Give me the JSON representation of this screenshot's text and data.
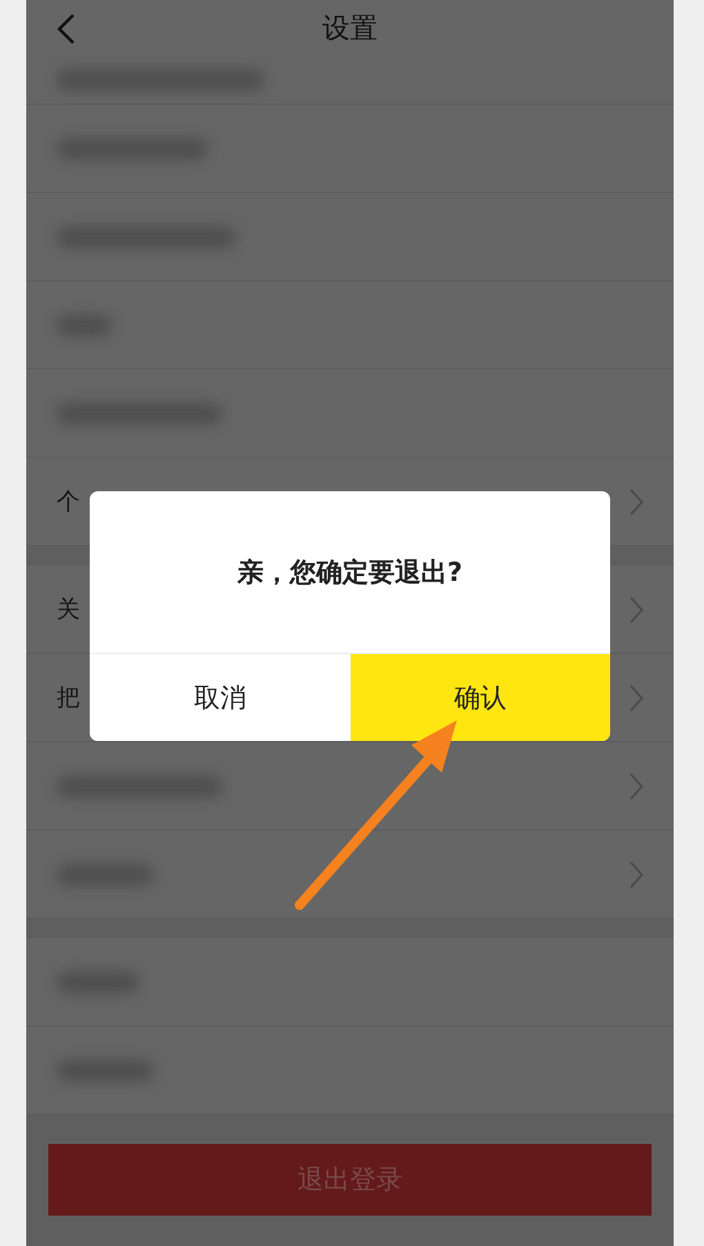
{
  "header": {
    "title": "设置"
  },
  "sections": [
    {
      "rows": [
        {
          "kind": "blurred",
          "chevron": false
        },
        {
          "kind": "blurred",
          "chevron": false
        },
        {
          "kind": "blurred",
          "chevron": false
        },
        {
          "kind": "blurred",
          "chevron": false
        },
        {
          "kind": "blurred",
          "chevron": false
        },
        {
          "kind": "text",
          "label": "个",
          "chevron": true
        }
      ]
    },
    {
      "rows": [
        {
          "kind": "text",
          "label": "关",
          "chevron": true
        },
        {
          "kind": "text",
          "label": "把",
          "chevron": true
        },
        {
          "kind": "blurred",
          "chevron": true
        },
        {
          "kind": "blurred",
          "chevron": true
        }
      ]
    },
    {
      "rows": [
        {
          "kind": "blurred",
          "chevron": false
        },
        {
          "kind": "blurred",
          "chevron": false
        }
      ]
    }
  ],
  "logout_button": {
    "label": "退出登录"
  },
  "dialog": {
    "message": "亲，您确定要退出?",
    "buttons": [
      {
        "label": "取消",
        "primary": false
      },
      {
        "label": "确认",
        "primary": true
      }
    ]
  },
  "annotation": {
    "kind": "arrow"
  }
}
